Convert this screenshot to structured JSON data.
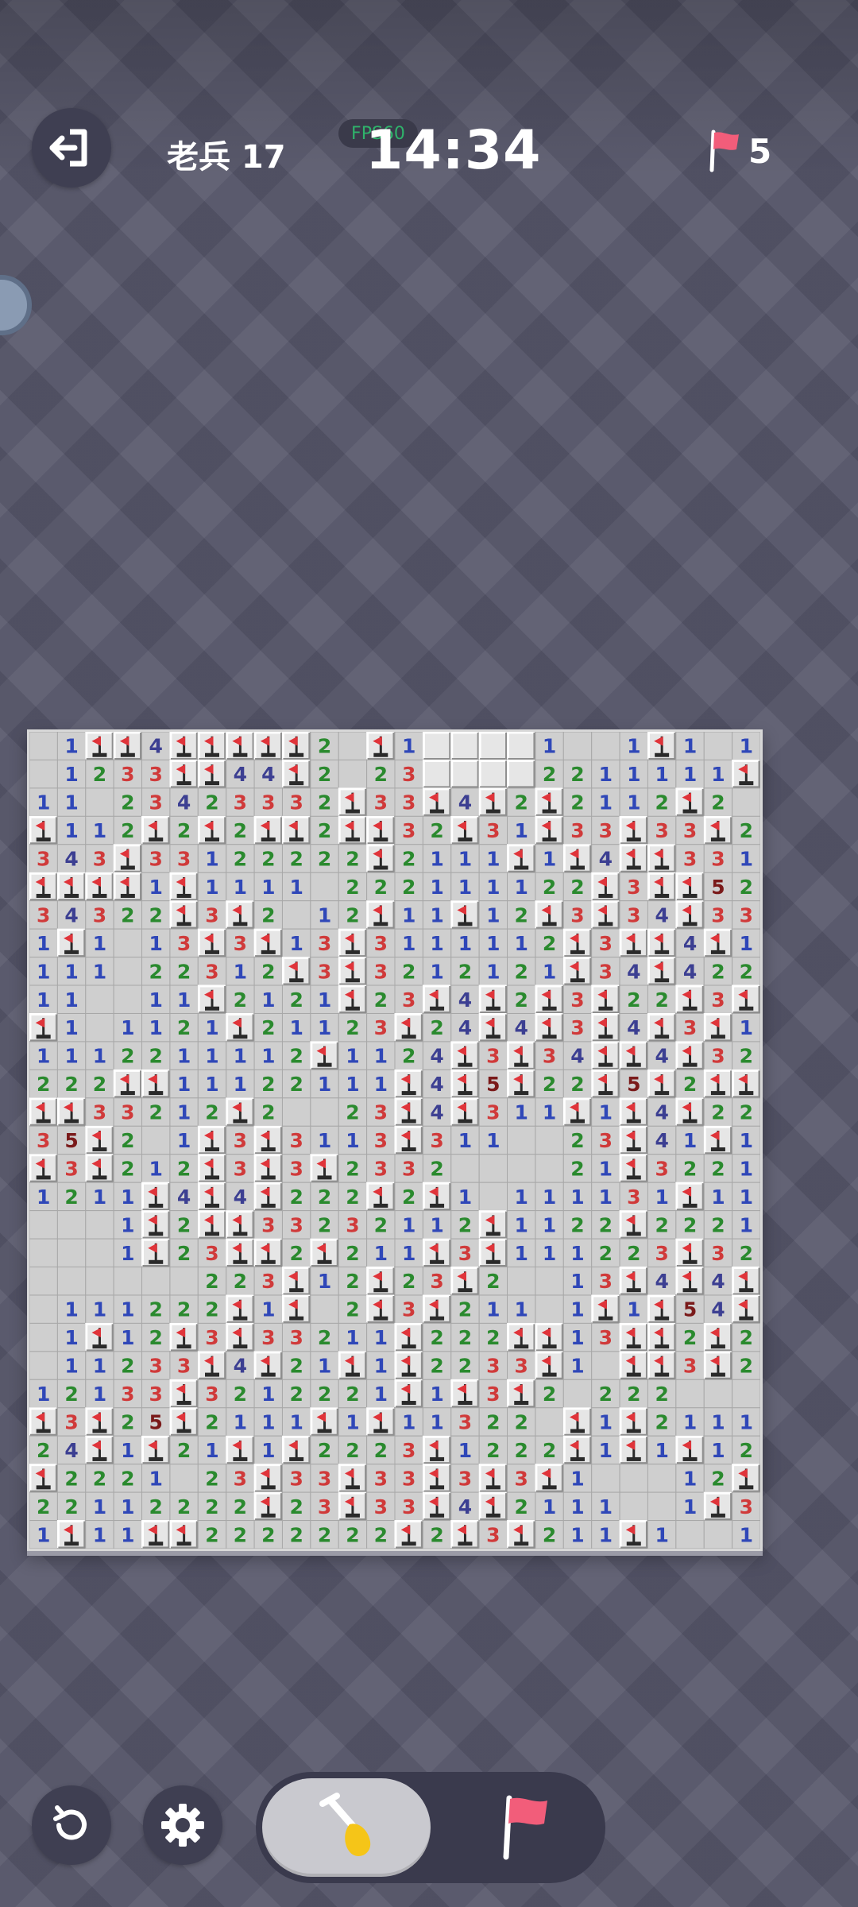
{
  "header": {
    "rank": "老兵 17",
    "fps": "FPS60",
    "timer": "14:34",
    "flags_remaining": "5"
  },
  "icons": {
    "exit": "exit-icon",
    "restart": "restart-icon",
    "settings": "gear-icon",
    "shovel": "shovel-icon",
    "flag": "flag-icon"
  },
  "colors": {
    "n1": "#2f47b8",
    "n2": "#2a8a2e",
    "n3": "#d03a3a",
    "n4": "#3c3f92",
    "n5": "#7a1a1a",
    "flag_red": "#e0343a",
    "cell_revealed": "#cfcfcf",
    "cell_covered": "#e6e6e6"
  },
  "board": {
    "cols": 26,
    "rows": 29,
    "legend": "digits = revealed count, 0 = empty, F = flag, U = unrevealed",
    "grid": [
      "01FF4FFFFF20F1UUUU1001F1011",
      "01233FF44F2023UUUU2211111F",
      "11023423332F33F4F2F2112F2",
      "F112F2F2FF2FF32F31F33F33F21",
      "343F33122222F2111F1F4FF331",
      "FFFF1F11110222111122F3FF52F",
      "34322F3F2012F11F12F3F34F331",
      "1F1013F3F13F3111112F3FF4F1",
      "111022312F3F3212121F34F422",
      "110011F2121F23F4F2F3F22F3F",
      "F101121F21123F24F4F3F4F3F11",
      "1112211112F1124F3F34FF4F3222",
      "222FF11122111F4F5F22F5F2FF",
      "FF33212F20023F4F311F1F4F2233",
      "35F201F3F3113F3110023F41F1F",
      "F3F212F3F3F2332000021F322111",
      "1211F4F4F222F2F10111131F111",
      "0001F2FF33232112F1122F2221F",
      "0001F23FF2F211F3F111223F322",
      "000000223F12F23F20013F4F4F1",
      "0111222F1F02F3F21101F1F54F21",
      "01F12F3F33211F222FF13FF2F21",
      "011233F4F21F1F2233F10FF3F2111F",
      "12133F3212221F1F3F20222000222",
      "F3F25F2111F1F113220F1F2111F",
      "24F1F21F1F2223F1222F1F1F1222",
      "F2221023F33F33F3F3F100012F34F",
      "22112222F23F33F4F2111001F3FF",
      "1F11FF2222222F2F3F211F1001F1FFUU"
    ]
  }
}
